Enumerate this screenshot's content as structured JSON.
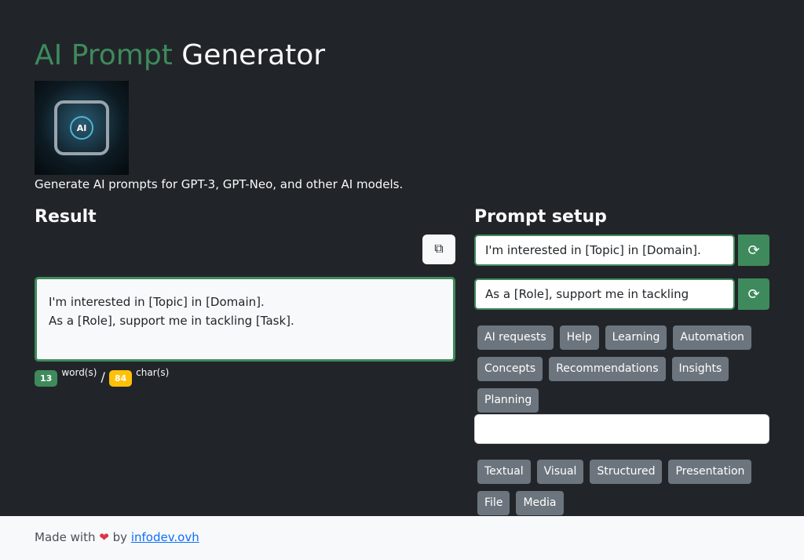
{
  "header": {
    "title_accent": "AI Prompt",
    "title_rest": "Generator",
    "description": "Generate AI prompts for GPT-3, GPT-Neo, and other AI models.",
    "logo_text": "AI"
  },
  "result": {
    "heading": "Result",
    "line1": "I'm interested in [Topic] in [Domain].",
    "line2": "As a [Role], support me in tackling [Task].",
    "word_count": "13",
    "word_label": "word(s)",
    "separator": "/",
    "char_count": "84",
    "char_label": "char(s)",
    "copy_icon": "copy-icon"
  },
  "setup": {
    "heading": "Prompt setup",
    "input1": "I'm interested in [Topic] in [Domain].",
    "input2": "As a [Role], support me in tackling [Task].",
    "refresh_icon": "refresh-icon",
    "tags1": [
      "AI requests",
      "Help",
      "Learning",
      "Automation",
      "Concepts",
      "Recommendations",
      "Insights",
      "Planning"
    ],
    "input3": "",
    "tags2": [
      "Textual",
      "Visual",
      "Structured",
      "Presentation",
      "File",
      "Media"
    ]
  },
  "footer": {
    "made_with": "Made with",
    "heart": "❤",
    "by": "by",
    "link": "infodev.ovh"
  },
  "colors": {
    "accent": "#3e8a5c",
    "background": "#212529",
    "tag": "#6c757d",
    "warning": "#ffc107"
  }
}
